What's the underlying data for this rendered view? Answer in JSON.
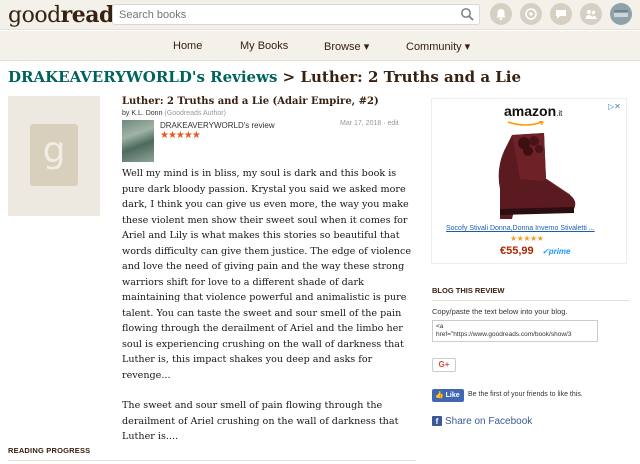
{
  "header": {
    "logo_light": "good",
    "logo_bold": "reads",
    "search_placeholder": "Search books",
    "icons": [
      "notifications-icon",
      "friends-icon",
      "messages-icon",
      "recommendations-icon",
      "profile-avatar"
    ]
  },
  "nav": {
    "items": [
      "Home",
      "My Books",
      "Browse ▾",
      "Community ▾"
    ]
  },
  "page": {
    "title_user": "DRAKEAVERYWORLD's Reviews",
    "title_sep": " > ",
    "title_book": "Luther: 2 Truths and a Lie"
  },
  "cover": {
    "glyph": "g"
  },
  "review": {
    "book_title": "Luther: 2 Truths and a Lie (Adair Empire, #2)",
    "by": "by K.L. Donn ",
    "author_role": "(Goodreads Author)",
    "reviewer_label": "DRAKEAVERYWORLD's review",
    "stars": "★★★★★",
    "rating": 5,
    "date": "Mar 17, 2018 · edit",
    "paragraph1": "Well my mind is in bliss, my soul is dark and this book is pure dark bloody passion. Krystal you said we asked more dark, I think you can give us even more, the way you make these violent men show their sweet soul when it comes for Ariel and Lily is what makes this stories so beautiful that words difficulty can give them justice. The edge of violence and love the need of giving pain and the way these strong warriors shift for love to a different shade of dark maintaining that violence powerful and animalistic is pure talent. You can taste the sweet and sour smell of the pain flowing through the derailment of Ariel and the limbo her soul is experiencing crushing on the wall of darkness that Luther is, this impact shakes you deep and asks for revenge...",
    "paragraph2": "The sweet and sour smell of pain flowing through the derailment of Ariel crushing on the wall of darkness that Luther is...."
  },
  "reading_progress": {
    "title": "READING PROGRESS"
  },
  "ad": {
    "logo": "amazon",
    "logo_tld": ".it",
    "close": "▷✕",
    "product": "Socofy Stivali Donna,Donna Inverno Stivaletti ...",
    "stars": "★★★★★",
    "price": "€55,99",
    "prime": "✓prime"
  },
  "blog": {
    "title": "BLOG THIS REVIEW",
    "instructions": "Copy/paste the text below into your blog.",
    "code_line1": "<a",
    "code_line2": "href=\"https://www.goodreads.com/book/show/3"
  },
  "social": {
    "gplus": "G+",
    "fb_like": "👍 Like",
    "fb_like_text": "Be the first of your friends to like this.",
    "fb_share": "Share on Facebook"
  }
}
